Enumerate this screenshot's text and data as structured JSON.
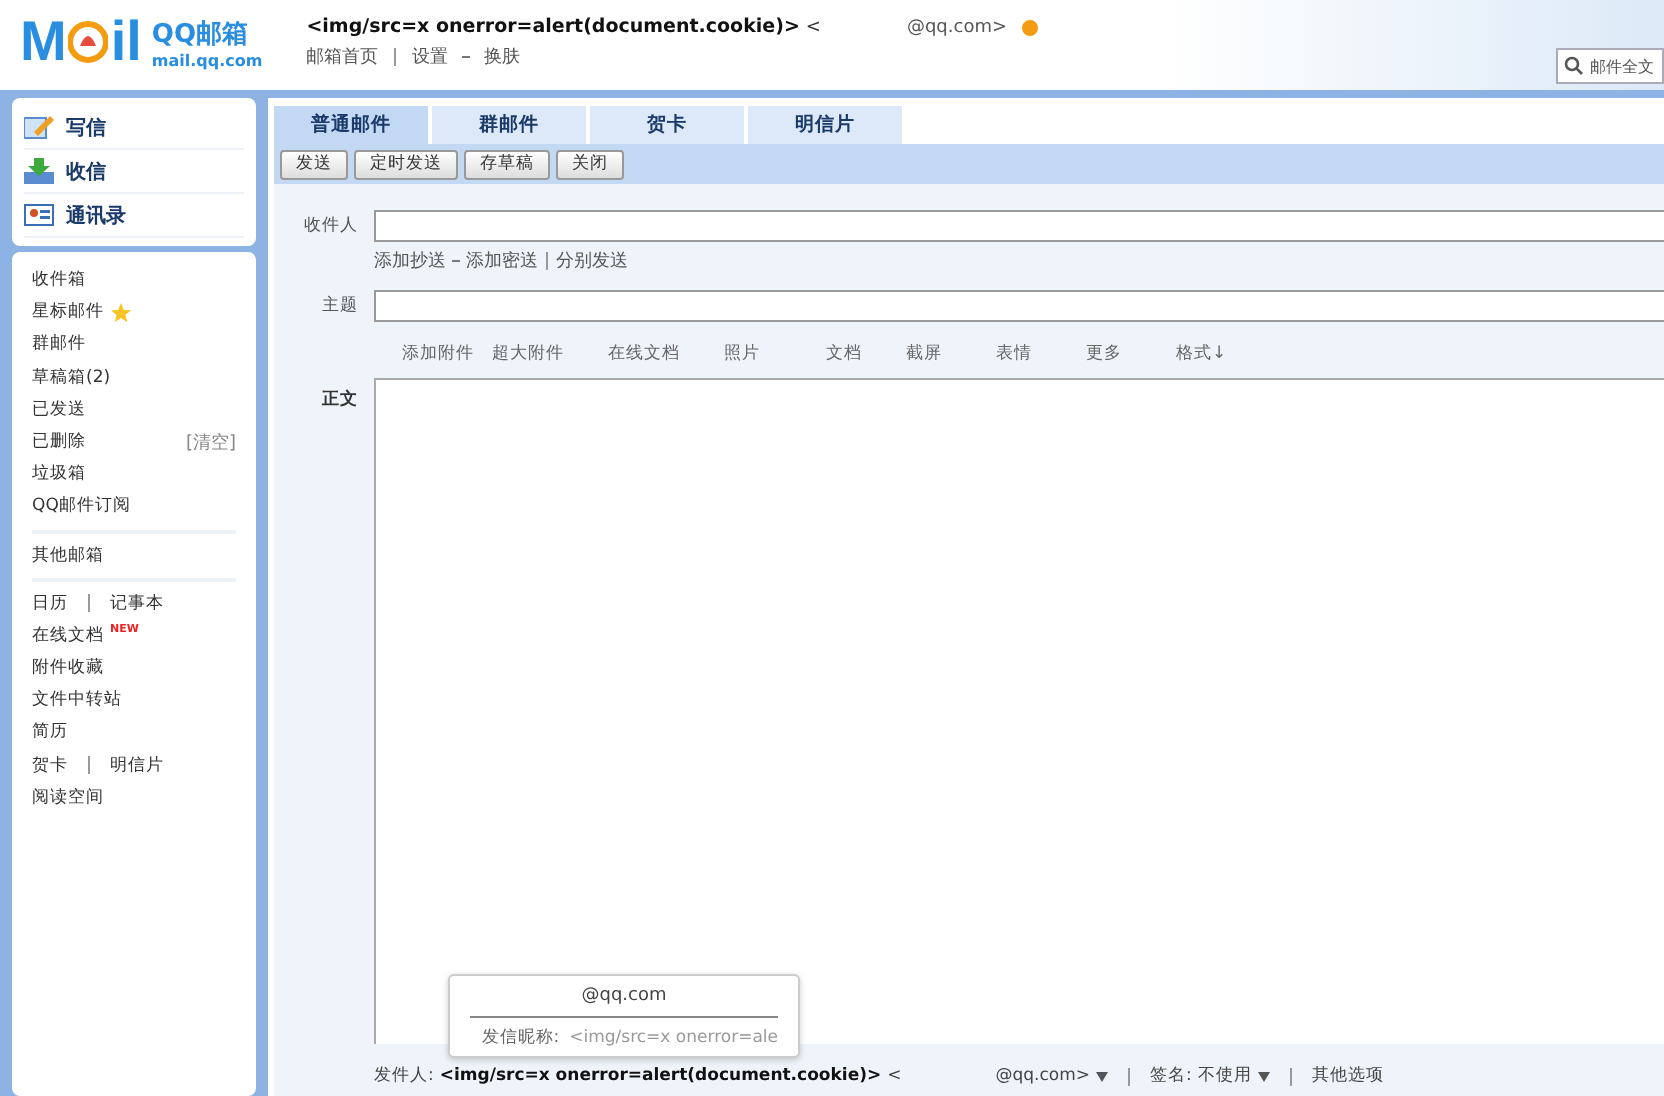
{
  "header": {
    "logo_word": "M",
    "logo_word2": "il",
    "brand": "QQ邮箱",
    "domain": "mail.qq.com",
    "user_name": "<img/src=x onerror=alert(document.cookie)>",
    "user_open": "<",
    "user_address": "@qq.com>",
    "links": [
      "邮箱首页",
      "设置",
      "换肤"
    ],
    "search": {
      "placeholder": "邮件全文"
    }
  },
  "sidebar": {
    "actions": [
      {
        "label": "写信",
        "kind": "write"
      },
      {
        "label": "收信",
        "kind": "receive"
      },
      {
        "label": "通讯录",
        "kind": "contacts"
      }
    ],
    "folders": [
      {
        "label": "收件箱"
      },
      {
        "label": "星标邮件",
        "starred": true
      },
      {
        "label": "群邮件"
      },
      {
        "label": "草稿箱(2)"
      },
      {
        "label": "已发送"
      },
      {
        "label": "已删除",
        "action": "[清空]"
      },
      {
        "label": "垃圾箱"
      },
      {
        "label": "QQ邮件订阅"
      }
    ],
    "other": "其他邮箱",
    "tools": [
      {
        "labels": [
          "日历",
          "记事本"
        ]
      },
      {
        "labels": [
          "在线文档"
        ],
        "badge": "NEW"
      },
      {
        "labels": [
          "附件收藏"
        ]
      },
      {
        "labels": [
          "文件中转站"
        ]
      },
      {
        "labels": [
          "简历"
        ]
      },
      {
        "labels": [
          "贺卡",
          "明信片"
        ]
      },
      {
        "labels": [
          "阅读空间"
        ]
      }
    ]
  },
  "tabs": [
    {
      "label": "普通邮件",
      "selected": true
    },
    {
      "label": "群邮件",
      "selected": false
    },
    {
      "label": "贺卡",
      "selected": false
    },
    {
      "label": "明信片",
      "selected": false
    }
  ],
  "toolbar": [
    "发送",
    "定时发送",
    "存草稿",
    "关闭"
  ],
  "form": {
    "to_label": "收件人",
    "to_links": [
      "添加抄送",
      "添加密送",
      "分别发送"
    ],
    "subject_label": "主题",
    "attach_tools": [
      "添加附件",
      "超大附件",
      "在线文档",
      "照片",
      "文档",
      "截屏",
      "表情",
      "更多",
      "格式↓"
    ],
    "body_label": "正文"
  },
  "popup": {
    "address": "@qq.com",
    "nickname_label": "发信昵称:",
    "nickname_value": "<img/src=x onerror=ale"
  },
  "footer": {
    "sender_label": "发件人:",
    "sender_name": "<img/src=x onerror=alert(document.cookie)>",
    "sender_open": "<",
    "sender_address": "@qq.com>",
    "signature_label": "签名:",
    "signature_value": "不使用",
    "other_options": "其他选项"
  }
}
